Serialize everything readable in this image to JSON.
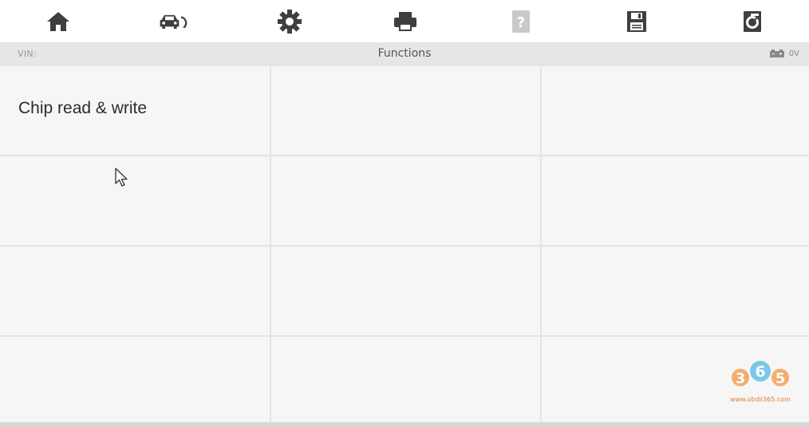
{
  "toolbar": {
    "buttons": [
      {
        "name": "home-icon",
        "enabled": true
      },
      {
        "name": "vehicle-swap-icon",
        "enabled": true
      },
      {
        "name": "settings-gear-icon",
        "enabled": true
      },
      {
        "name": "print-icon",
        "enabled": true
      },
      {
        "name": "help-icon",
        "enabled": false
      },
      {
        "name": "save-icon",
        "enabled": true
      },
      {
        "name": "data-logging-icon",
        "enabled": true
      }
    ],
    "icon_color": "#3f3f3f",
    "disabled_color": "#c9c9c9"
  },
  "statusbar": {
    "vin_label": "VIN:",
    "title": "Functions",
    "battery_icon": "car-battery-icon",
    "voltage": "0V"
  },
  "functions": {
    "cells": [
      {
        "label": "Chip read & write"
      },
      {
        "label": ""
      },
      {
        "label": ""
      },
      {
        "label": ""
      },
      {
        "label": ""
      },
      {
        "label": ""
      },
      {
        "label": ""
      },
      {
        "label": ""
      },
      {
        "label": ""
      },
      {
        "label": ""
      },
      {
        "label": ""
      },
      {
        "label": ""
      }
    ]
  },
  "watermark": {
    "logo": "365-logo",
    "site": "www.obdii365.com"
  },
  "colors": {
    "background": "#f6f6f7",
    "grid_line": "#e4e4e4",
    "status_bar": "#e6e6e6"
  }
}
